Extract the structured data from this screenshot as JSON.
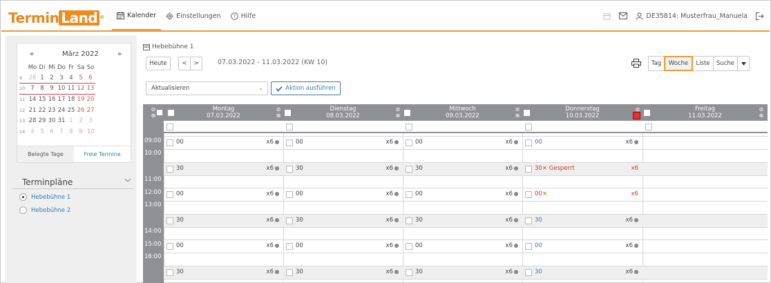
{
  "app": {
    "logo_left": "Termin",
    "logo_box": "Land",
    "logo_reg": "®"
  },
  "nav": {
    "calendar": "Kalender",
    "settings": "Einstellungen",
    "help": "Hilfe"
  },
  "user": {
    "label": "DE35814: Musterfrau_Manuela"
  },
  "mini_calendar": {
    "prev": "«",
    "next": "»",
    "month": "März 2022",
    "weekdays": [
      "Mo",
      "Di",
      "Mi",
      "Do",
      "Fr",
      "Sa",
      "So"
    ],
    "weeks": [
      {
        "kw": "9",
        "days": [
          "28",
          "1",
          "2",
          "3",
          "4",
          "5",
          "6"
        ]
      },
      {
        "kw": "10",
        "days": [
          "7",
          "8",
          "9",
          "10",
          "11",
          "12",
          "13"
        ]
      },
      {
        "kw": "11",
        "days": [
          "14",
          "15",
          "16",
          "17",
          "18",
          "19",
          "20"
        ]
      },
      {
        "kw": "12",
        "days": [
          "21",
          "22",
          "23",
          "24",
          "25",
          "26",
          "27"
        ]
      },
      {
        "kw": "13",
        "days": [
          "28",
          "29",
          "30",
          "31",
          "1",
          "2",
          "3"
        ]
      },
      {
        "kw": "14",
        "days": [
          "4",
          "5",
          "6",
          "7",
          "8",
          "9",
          "10"
        ]
      }
    ],
    "tab_busy": "Belegte Tage",
    "tab_free": "Freie Termine"
  },
  "schedules": {
    "title": "Terminpläne",
    "items": [
      {
        "label": "Hebebühne 1",
        "selected": true
      },
      {
        "label": "Hebebühne 2",
        "selected": false
      }
    ]
  },
  "toolbar": {
    "room": "Hebebühne 1",
    "today": "Heute",
    "prev": "<",
    "next": ">",
    "range": "07.03.2022 - 11.03.2022 (KW 10)",
    "refresh_select": "Aktualisieren",
    "action_button": "Aktion ausführen",
    "views": [
      "Tag",
      "Woche",
      "Liste",
      "Suche"
    ],
    "active_view": "Woche"
  },
  "days": [
    {
      "name": "Montag",
      "date": "07.03.2022"
    },
    {
      "name": "Dienstag",
      "date": "08.03.2022"
    },
    {
      "name": "Mittwoch",
      "date": "09.03.2022"
    },
    {
      "name": "Donnerstag",
      "date": "10.03.2022"
    },
    {
      "name": "Freitag",
      "date": "11.03.2022"
    }
  ],
  "times": [
    "09:00",
    "10:00",
    "11:00",
    "12:00",
    "13:00",
    "14:00",
    "15:00",
    "16:00"
  ],
  "slots": {
    "r0": [
      {
        "l": "00",
        "c": "x6"
      },
      {
        "l": "00",
        "c": "x6"
      },
      {
        "l": "00",
        "c": "x6"
      },
      {
        "l": "00",
        "c": "x6"
      }
    ],
    "r1": [
      {
        "l": "30",
        "c": "x6"
      },
      {
        "l": "30",
        "c": "x6"
      },
      {
        "l": "30",
        "c": "x6"
      },
      {
        "l": "30× Gesperrt",
        "c": "x6"
      }
    ],
    "r2": [
      {
        "l": "00",
        "c": "x6"
      },
      {
        "l": "00",
        "c": "x6"
      },
      {
        "l": "00",
        "c": "x6"
      },
      {
        "l": "00×",
        "c": "x6"
      }
    ],
    "r3": [
      {
        "l": "30",
        "c": "x6"
      },
      {
        "l": "30",
        "c": "x6"
      },
      {
        "l": "30",
        "c": "x6"
      },
      {
        "l": "30",
        "c": "x6"
      }
    ],
    "r4": [
      {
        "l": "00",
        "c": "x6"
      },
      {
        "l": "00",
        "c": "x6"
      },
      {
        "l": "00",
        "c": "x6"
      },
      {
        "l": "00",
        "c": "x6"
      }
    ],
    "r5": [
      {
        "l": "30",
        "c": "x6"
      },
      {
        "l": "30",
        "c": "x6"
      },
      {
        "l": "30",
        "c": "x6"
      },
      {
        "l": "30",
        "c": "x6"
      }
    ]
  },
  "icons": {
    "calendar": "calendar-icon",
    "settings": "gear-icon",
    "help": "help-icon",
    "mail": "mail-icon",
    "user": "user-icon",
    "logout": "logout-icon",
    "print": "print-icon"
  },
  "colors": {
    "accent": "#ee9a34",
    "link": "#3a78b7",
    "blocked": "#d9302b",
    "grid_header": "#8f8f96"
  }
}
